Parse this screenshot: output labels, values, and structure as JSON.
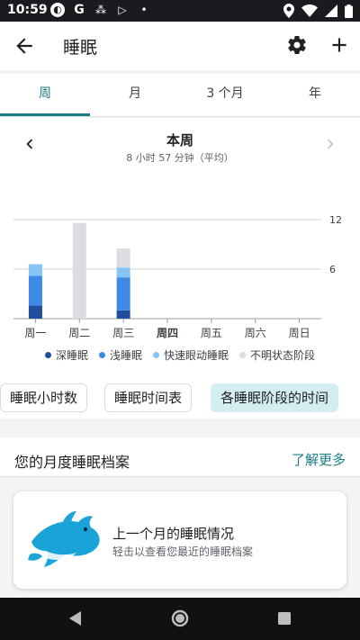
{
  "status_bar": {
    "time": "10:59",
    "left_icons": [
      "notification-circle-icon",
      "google-icon",
      "connection-icon",
      "play-store-icon",
      "dot-icon"
    ],
    "right_icons": [
      "location-icon",
      "wifi-icon",
      "signal-icon",
      "battery-icon"
    ]
  },
  "app_bar": {
    "title": "睡眠",
    "back_icon": "arrow-left-icon",
    "settings_icon": "gear-icon",
    "add_icon": "plus-icon"
  },
  "tabs": [
    {
      "label": "周",
      "active": true
    },
    {
      "label": "月",
      "active": false
    },
    {
      "label": "3 个月",
      "active": false
    },
    {
      "label": "年",
      "active": false
    }
  ],
  "period": {
    "title": "本周",
    "subtitle": "8 小时 57 分钟（平均）"
  },
  "chart_data": {
    "type": "bar",
    "stacked": true,
    "categories": [
      "周一",
      "周二",
      "周三",
      "周四",
      "周五",
      "周六",
      "周日"
    ],
    "current_day": "周四",
    "yticks": [
      "6",
      "12"
    ],
    "ylim": [
      0,
      12
    ],
    "grid": true,
    "series": [
      {
        "name": "深睡眠",
        "color": "#1f4e9c",
        "values": [
          1.6,
          0,
          1.0,
          0,
          0,
          0,
          0
        ]
      },
      {
        "name": "浅睡眠",
        "color": "#3d8ae6",
        "values": [
          3.6,
          0,
          4.0,
          0,
          0,
          0,
          0
        ]
      },
      {
        "name": "快速眼动睡眠",
        "color": "#86c4f5",
        "values": [
          1.4,
          0,
          1.2,
          0,
          0,
          0,
          0
        ]
      },
      {
        "name": "不明状态阶段",
        "color": "#dcdde0",
        "values": [
          0,
          11.6,
          2.3,
          0,
          0,
          0,
          0
        ]
      }
    ]
  },
  "chips": [
    {
      "label": "睡眠小时数",
      "active": false
    },
    {
      "label": "睡眠时间表",
      "active": false
    },
    {
      "label": "各睡眠阶段的时间",
      "active": true
    }
  ],
  "profile": {
    "title": "您的月度睡眠档案",
    "learn_more": "了解更多",
    "card_title": "上一个月的睡眠情况",
    "card_subtitle": "轻击以查看您最近的睡眠档案",
    "card_image": "dolphin-icon"
  },
  "colors": {
    "accent": "#1a7d85",
    "chip_active_bg": "#d3eef0"
  }
}
